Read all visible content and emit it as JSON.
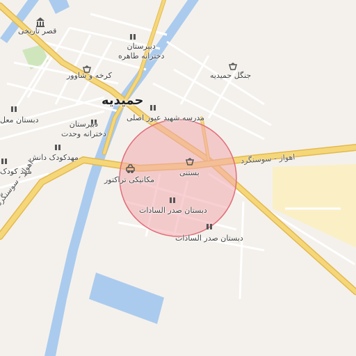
{
  "map": {
    "city_label": "حمیدیه",
    "labels": {
      "historic_palace": "قصر تاریخی",
      "school_girls_tahereh": "دبیرستان\nدخترانه طاهره",
      "karkheh_shower": "کرخه و شاوور",
      "jungle_hamidiyeh": "جنگل حمیدیه",
      "school_shahid_eyour": "مدرسه شهید عیور اصلی",
      "school_left_partial": "دبستان معل",
      "school_girls_vahdat": "دبیرستان\nدخترانه وحدت",
      "kindergarten_danesh": "مهدکودک دانش",
      "kindergarten_partial": "مهد کودک",
      "tractor_mechanic": "مکانیکی تراکتور",
      "bastani": "بستنی",
      "school_sadr_1": "دبستان صدر السادات",
      "school_sadr_2": "دبستان صدر السادات"
    },
    "roads": {
      "ahvaz_susangerd_right": "اهواز - سوسنگرد",
      "ahvaz_susangerd_left": "اهواز - سوسنگرد"
    },
    "colors": {
      "background": "#f4f1ec",
      "water": "#aacbee",
      "main_road": "#f5d77a",
      "road_outline": "#e3b94d",
      "minor_road": "#ffffff",
      "highlight_fill": "#f2a9ae",
      "highlight_stroke": "#e26d79",
      "industrial": "#fbefc6",
      "park": "#cfe6bd"
    },
    "icons": {
      "school": "school-icon",
      "museum": "museum-icon",
      "shop": "shop-icon",
      "car": "car-repair-icon"
    }
  }
}
